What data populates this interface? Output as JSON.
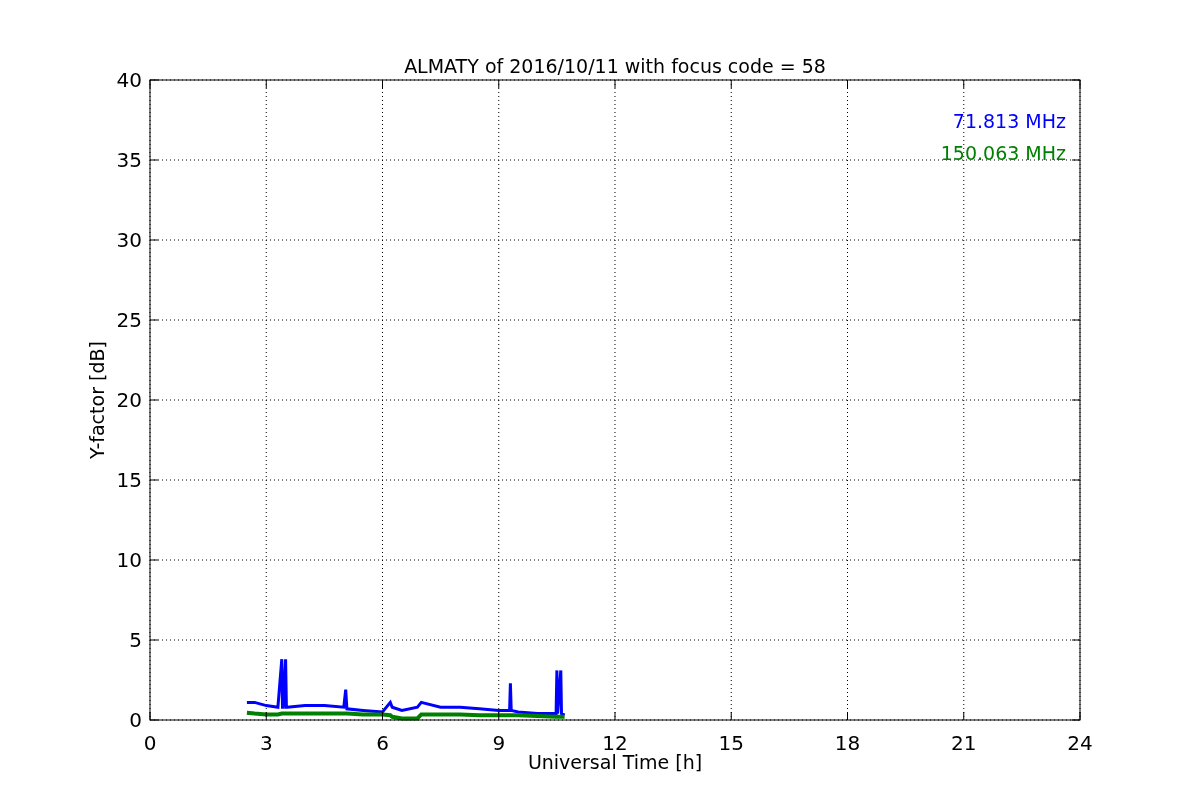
{
  "chart_data": {
    "type": "line",
    "title": "ALMATY of 2016/10/11 with focus code = 58",
    "xlabel": "Universal Time [h]",
    "ylabel": "Y-factor [dB]",
    "xlim": [
      0,
      24
    ],
    "ylim": [
      0,
      40
    ],
    "xticks": [
      0,
      3,
      6,
      9,
      12,
      15,
      18,
      21,
      24
    ],
    "yticks": [
      0,
      5,
      10,
      15,
      20,
      25,
      30,
      35,
      40
    ],
    "grid": true,
    "x": [
      2.5,
      2.7,
      3.0,
      3.3,
      3.4,
      3.42,
      3.44,
      3.5,
      3.52,
      3.54,
      4.0,
      4.5,
      5.0,
      5.05,
      5.08,
      5.5,
      6.0,
      6.2,
      6.25,
      6.5,
      6.9,
      7.0,
      7.5,
      8.0,
      8.5,
      9.0,
      9.28,
      9.3,
      9.32,
      9.5,
      10.0,
      10.48,
      10.5,
      10.52,
      10.6,
      10.62,
      10.7
    ],
    "series": [
      {
        "name": "71.813 MHz",
        "color": "#0000ff",
        "values": [
          1.1,
          1.1,
          0.9,
          0.8,
          3.8,
          0.8,
          0.8,
          3.8,
          0.8,
          0.8,
          0.9,
          0.9,
          0.8,
          1.9,
          0.7,
          0.6,
          0.5,
          1.1,
          0.8,
          0.6,
          0.8,
          1.1,
          0.8,
          0.8,
          0.7,
          0.6,
          0.6,
          2.3,
          0.6,
          0.5,
          0.4,
          0.4,
          3.1,
          0.4,
          3.1,
          0.4,
          0.3
        ]
      },
      {
        "name": "150.063 MHz",
        "color": "#008000",
        "values": [
          0.45,
          0.4,
          0.35,
          0.35,
          0.4,
          0.4,
          0.4,
          0.4,
          0.4,
          0.4,
          0.4,
          0.4,
          0.4,
          0.4,
          0.4,
          0.35,
          0.35,
          0.3,
          0.2,
          0.1,
          0.1,
          0.35,
          0.35,
          0.35,
          0.3,
          0.3,
          0.3,
          0.3,
          0.3,
          0.3,
          0.25,
          0.2,
          0.2,
          0.2,
          0.2,
          0.2,
          0.2
        ]
      }
    ]
  }
}
